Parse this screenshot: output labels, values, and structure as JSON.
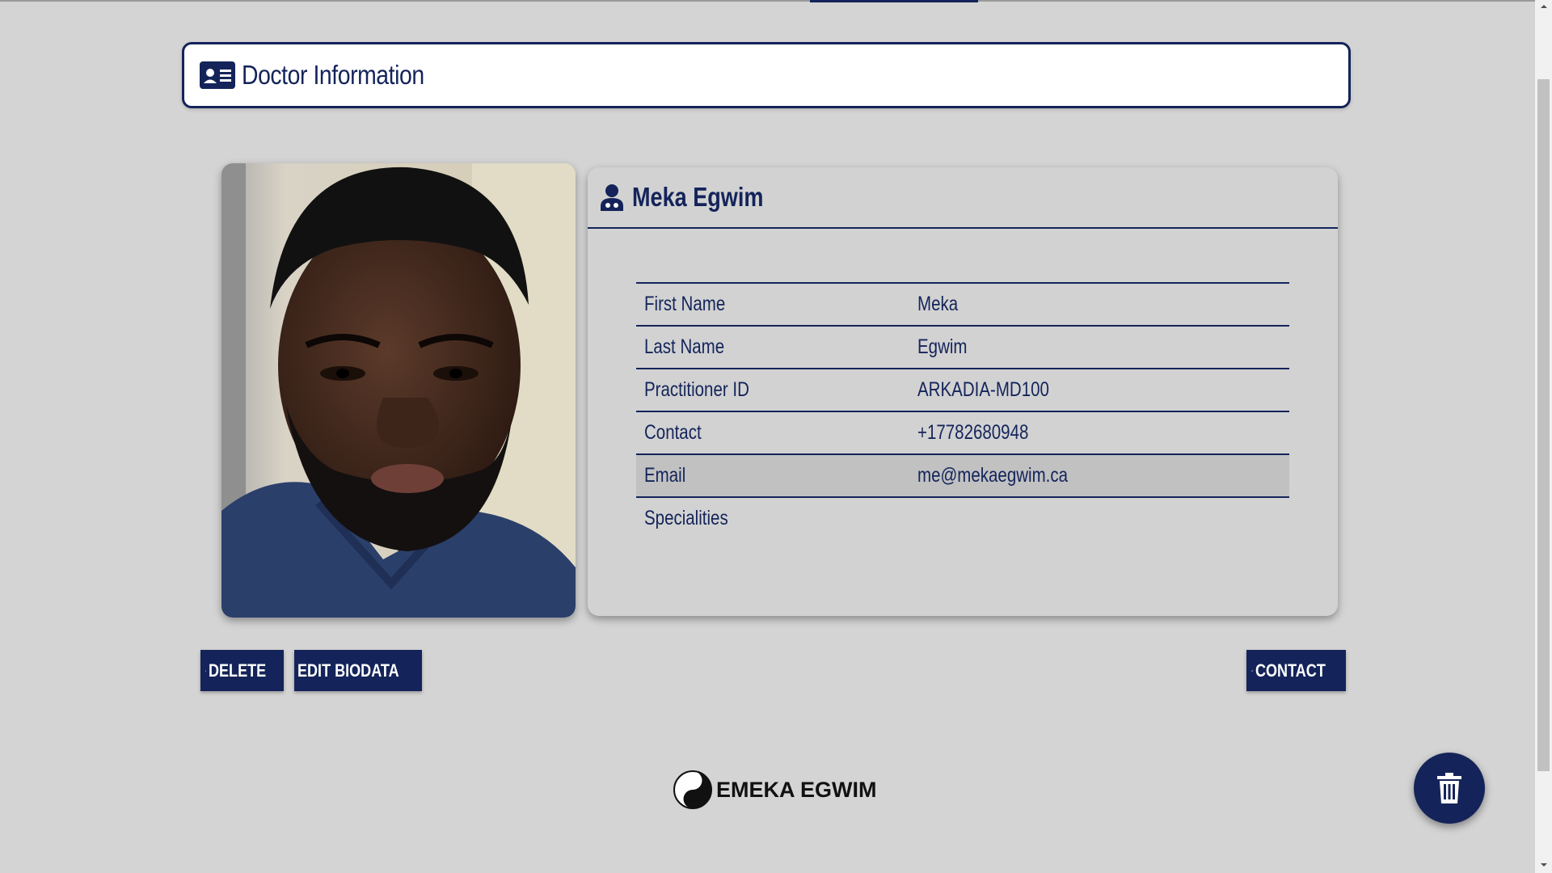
{
  "header": {
    "title": "Doctor Information",
    "icon": "id-card-icon"
  },
  "profile": {
    "name": "Meka Egwim",
    "icon": "user-doctor-icon",
    "photo": "portrait-photo"
  },
  "details": {
    "rows": [
      {
        "label": "First Name",
        "value": "Meka"
      },
      {
        "label": "Last Name",
        "value": "Egwim"
      },
      {
        "label": "Practitioner ID",
        "value": "ARKADIA-MD100"
      },
      {
        "label": "Contact",
        "value": "+17782680948"
      },
      {
        "label": "Email",
        "value": "me@mekaegwim.ca"
      },
      {
        "label": "Specialities",
        "value": ""
      }
    ]
  },
  "actions": {
    "delete_label": "DELETE",
    "edit_label": "EDIT BIODATA",
    "contact_label": "CONTACT"
  },
  "footer": {
    "brand": "EMEKA EGWIM",
    "logo_icon": "yin-yang-icon"
  },
  "fab": {
    "icon": "trash-icon"
  },
  "colors": {
    "primary": "#14245a",
    "background": "#d4d4d4",
    "card": "#d2d2d2",
    "row_highlight": "#c1c1c1"
  }
}
